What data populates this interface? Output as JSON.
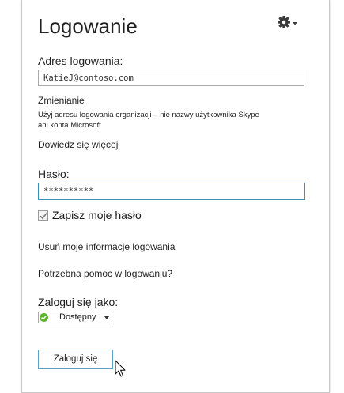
{
  "header": {
    "title": "Logowanie",
    "settings_icon": "gear-icon"
  },
  "signin_address": {
    "label": "Adres logowania:",
    "value": "KatieJ@contoso.com"
  },
  "change": {
    "heading": "Zmienianie",
    "line1": "Użyj adresu logowania organizacji – nie nazwy użytkownika Skype",
    "line2": "ani konta Microsoft",
    "learn_more": "Dowiedz się więcej"
  },
  "password": {
    "label": "Hasło:",
    "value": "**********"
  },
  "remember": {
    "label": "Zapisz moje hasło",
    "checked": true
  },
  "links": {
    "delete_info": "Usuń moje informacje logowania",
    "help": "Potrzebna pomoc w logowaniu?"
  },
  "presence": {
    "label": "Zaloguj się jako:",
    "selected": "Dostępny",
    "status_color": "#5db42b"
  },
  "signin_button": {
    "label": "Zaloguj się"
  },
  "colors": {
    "focus_border": "#3c8fb7",
    "button_border": "#5aa3c8"
  }
}
